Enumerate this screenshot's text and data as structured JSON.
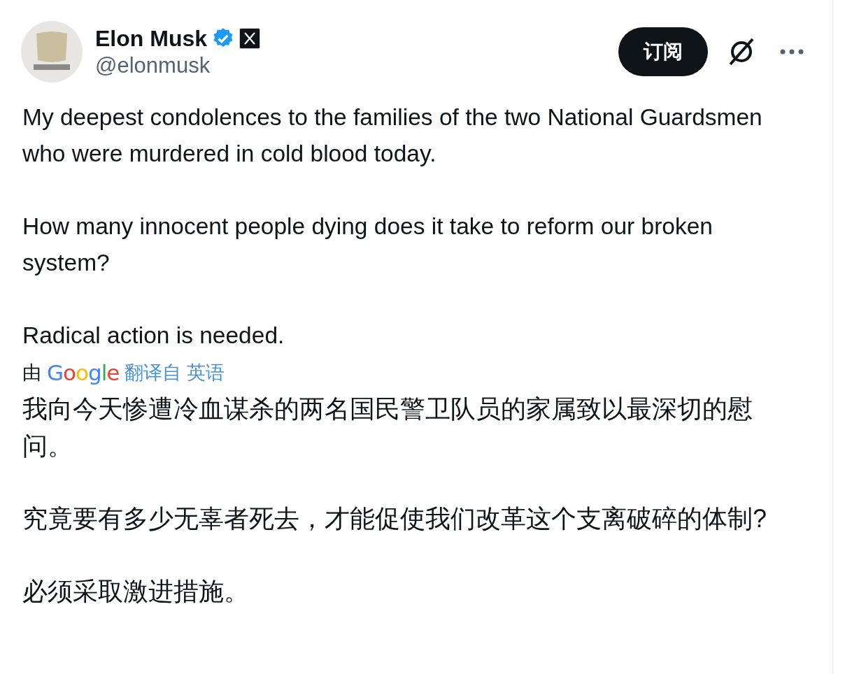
{
  "author": {
    "name": "Elon Musk",
    "verified": true,
    "handle": "@elonmusk"
  },
  "subscribe_button": "订阅",
  "post": {
    "paragraphs": [
      "My deepest condolences to the families of the two National Guardsmen who were murdered in cold blood today.",
      "How many innocent people dying does it take to reform our broken system?",
      "Radical action is needed."
    ]
  },
  "translation": {
    "prefix": "由",
    "service": "Google",
    "link": "翻译自 英语",
    "paragraphs": [
      "我向今天惨遭冷血谋杀的两名国民警卫队员的家属致以最深切的慰问。",
      "究竟要有多少无辜者死去，才能促使我们改革这个支离破碎的体制?",
      "必须采取激进措施。"
    ]
  }
}
